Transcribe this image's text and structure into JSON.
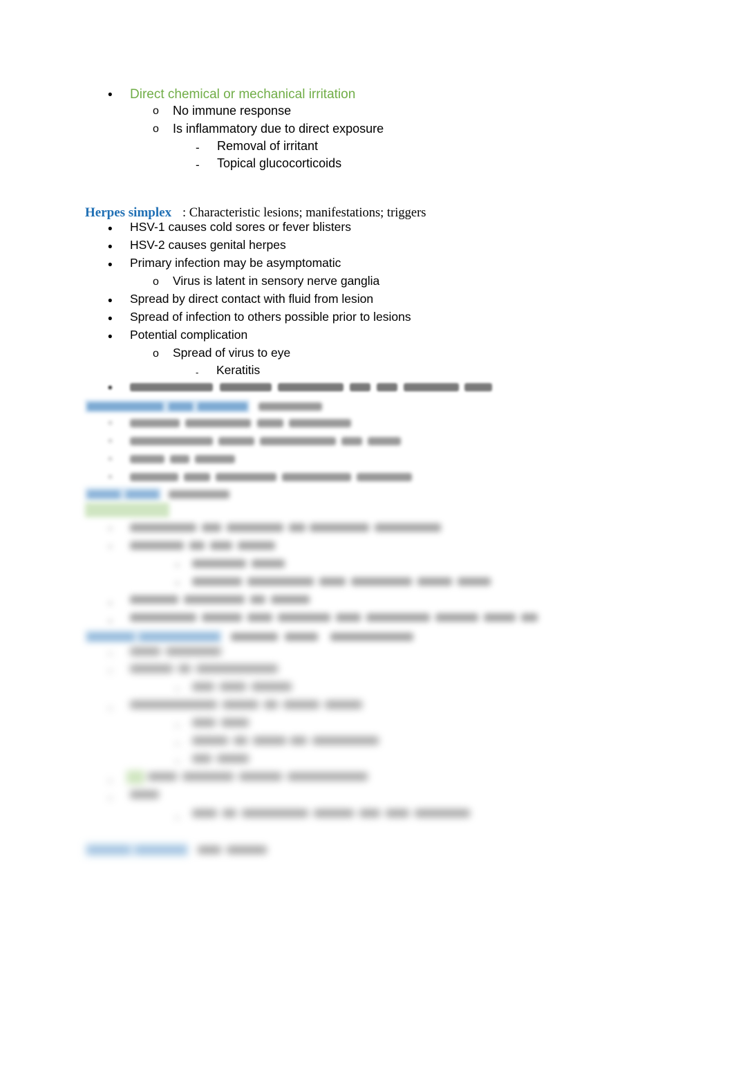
{
  "document": {
    "page_background": "#ffffff",
    "accent_green": "#70AD47",
    "accent_blue": "#1F6FB4",
    "highlight_green": "#C5E0B4",
    "highlight_blue": "#BDD7EE"
  },
  "section_irritation": {
    "bullet_marker": "•",
    "title": "Direct chemical or mechanical irritation",
    "sub_marker": "o",
    "sub_items": [
      "No immune response",
      "Is inflammatory due to direct exposure"
    ],
    "dash_marker": "-",
    "dash_items": [
      "Removal of irritant",
      "Topical glucocorticoids"
    ]
  },
  "section_herpes": {
    "heading_label": "Herpes simplex",
    "heading_rest": ":  Characteristic lesions; manifestations; triggers",
    "bullet_marker": "•",
    "sub_marker": "o",
    "dash_marker": "-",
    "items": [
      "HSV-1 causes cold sores or fever blisters",
      "HSV-2 causes genital herpes",
      "Primary infection may be asymptomatic"
    ],
    "sub_item_1": "Virus is latent in sensory nerve ganglia",
    "items_2": [
      "Spread by direct contact with fluid from lesion",
      "Spread of infection to others possible prior to lesions",
      "Potential complication"
    ],
    "sub_item_2": "Spread of virus to eye",
    "dash_item_1": "Keratitis"
  },
  "degraded_region": {
    "note_visible_text": "",
    "legibility": "illegible",
    "blue_heading_count": 4,
    "green_highlight_present": true
  }
}
